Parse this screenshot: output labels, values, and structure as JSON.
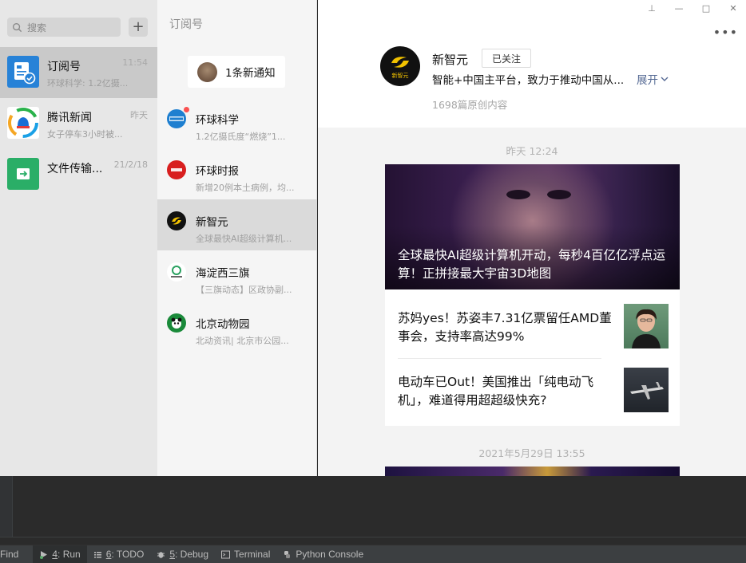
{
  "search": {
    "placeholder": "搜索"
  },
  "chats": [
    {
      "name": "订阅号",
      "time": "11:54",
      "preview": "环球科学: 1.2亿摄..."
    },
    {
      "name": "腾讯新闻",
      "time": "昨天",
      "preview": "女子停车3小时被..."
    },
    {
      "name": "文件传输...",
      "time": "21/2/18",
      "preview": ""
    }
  ],
  "subscriptions": {
    "title": "订阅号",
    "notice": "1条新通知",
    "items": [
      {
        "name": "环球科学",
        "preview": "1.2亿摄氏度“燃烧”1..."
      },
      {
        "name": "环球时报",
        "preview": "新增20例本土病例，均..."
      },
      {
        "name": "新智元",
        "preview": "全球最快AI超级计算机..."
      },
      {
        "name": "海淀西三旗",
        "preview": "【三旗动态】区政协副..."
      },
      {
        "name": "北京动物园",
        "preview": "北动资讯| 北京市公园..."
      }
    ]
  },
  "profile": {
    "name": "新智元",
    "follow_label": "已关注",
    "description": "智能+中国主平台，致力于推动中国从...",
    "expand_label": "展开",
    "article_count": "1698篇原创内容",
    "logo_text": "新智元"
  },
  "feed": {
    "timestamp1": "昨天 12:24",
    "hero_title": "全球最快AI超级计算机开动，每秒4百亿亿浮点运算！正拼接最大宇宙3D地图",
    "articles": [
      {
        "title": "苏妈yes！苏姿丰7.31亿票留任AMD董事会，支持率高达99%"
      },
      {
        "title": "电动车已Out！美国推出「纯电动飞机」，难道得用超超级快充?"
      }
    ],
    "timestamp2": "2021年5月29日 13:55"
  },
  "ide_toolbar": {
    "find": "Find",
    "run_key": "4",
    "run": ": Run",
    "todo_key": "6",
    "todo": ": TODO",
    "debug_key": "5",
    "debug": ": Debug",
    "terminal": "Terminal",
    "python_console": "Python Console"
  },
  "colors": {
    "accent_link": "#576b95",
    "badge_red": "#fa5151",
    "file_transfer_green": "#2aae67",
    "subscription_blue": "#2782d7"
  }
}
